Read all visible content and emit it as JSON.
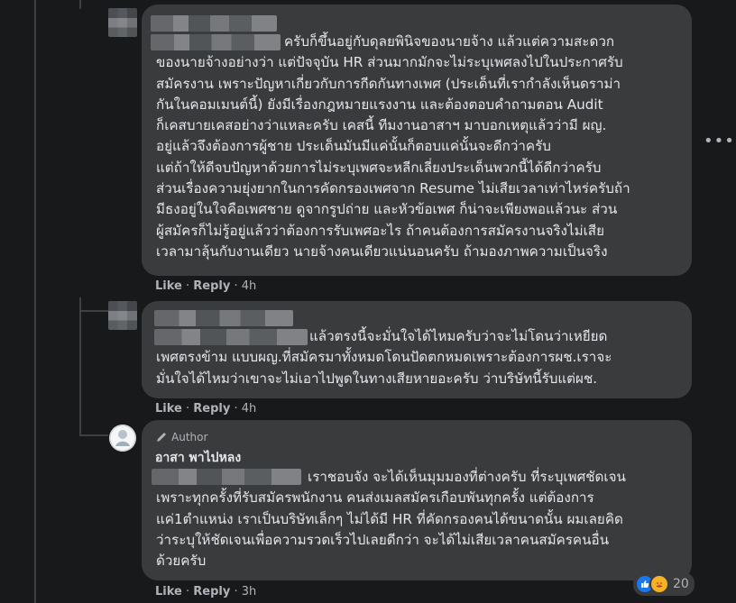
{
  "comments": [
    {
      "lines": [
        "ครับก็ขึ้นอยู่กับดุลยพินิจของนายจ้าง แล้วแต่ความสะดวก",
        "ของนายจ้างอย่างว่า แต่ปัจจุบัน HR ส่วนมากมักจะไม่ระบุเพศลงไปในประกาศรับ",
        "สมัครงาน เพราะปัญหาเกี่ยวกับการกีดกันทางเพศ (ประเด็นที่เรากำลังเห็นดราม่า",
        "กันในคอมเมนต์นี้) ยังมีเรื่องกฎหมายแรงงาน และต้องตอบคำถามตอน Audit",
        "ก็เคสบายเคสอย่างว่าแหละครับ เคสนี้ ทีมงานอาสาฯ มาบอกเหตุแล้วว่ามี ผญ.",
        "อยู่แล้วจึงต้องการผู้ชาย ประเด็นมันมีแค่นั้นก็ตอบแค่นั้นจะดีกว่าครับ",
        "แต่ถ้าให้ดีจบปัญหาด้วยการไม่ระบุเพศจะหลีกเลี่ยงประเด็นพวกนี้ได้ดีกว่าครับ",
        "ส่วนเรื่องความยุ่งยากในการคัดกรองเพศจาก Resume ไม่เสียเวลาเท่าไหร่ครับถ้า",
        "มีธงอยู่ในใจคือเพศชาย ดูจากรูปถ่าย และหัวข้อเพศ ก็น่าจะเพียงพอแล้วนะ ส่วน",
        "ผู้สมัครก็ไม่รู้อยู่แล้วว่าต้องการรับเพศอะไร ถ้าคนต้องการสมัครงานจริงไม่เสีย",
        "เวลามาลุ้นกับงานเดียว นายจ้างคนเดียวแน่นอนครับ ถ้ามองภาพความเป็นจริง"
      ],
      "like": "Like",
      "reply": "Reply",
      "time": "4h"
    },
    {
      "lines": [
        "แล้วตรงนี้จะมั่นใจได้ไหมครับว่าจะไม่โดนว่าเหยียด",
        "เพศตรงข้าม แบบผญ.ที่สมัครมาทั้งหมดโดนปัดตกหมดเพราะต้องการผช.เราจะ",
        "มั่นใจได้ไหมว่าเขาจะไม่เอาไปพูดในทางเสียหายอะครับ ว่าบริษัทนี้รับแต่ผช."
      ],
      "like": "Like",
      "reply": "Reply",
      "time": "4h"
    },
    {
      "badge": "Author",
      "name": "อาสา พาไปหลง",
      "lines": [
        "เราชอบจัง จะได้เห็นมุมมองที่ต่างครับ ที่ระบุเพศชัดเจน",
        "เพราะทุกครั้งที่รับสมัครพนักงาน คนส่งเมลสมัครเกือบพันทุกครั้ง แต่ต้องการ",
        "แค่1ตำแหน่ง เราเป็นบริษัทเล็กๆ ไม่ได้มี HR ที่คัดกรองคนได้ขนาดนั้น ผมเลยคิด",
        "ว่าระบุให้ชัดเจนเพื่อความรวดเร็วไปเลยดีกว่า จะได้ไม่เสียเวลาคนสมัครคนอื่น",
        "ด้วยครับ"
      ],
      "like": "Like",
      "reply": "Reply",
      "time": "3h",
      "reaction_count": "20",
      "reaction_icons": [
        "like-reaction",
        "care-reaction"
      ]
    }
  ],
  "more_label": "•••"
}
